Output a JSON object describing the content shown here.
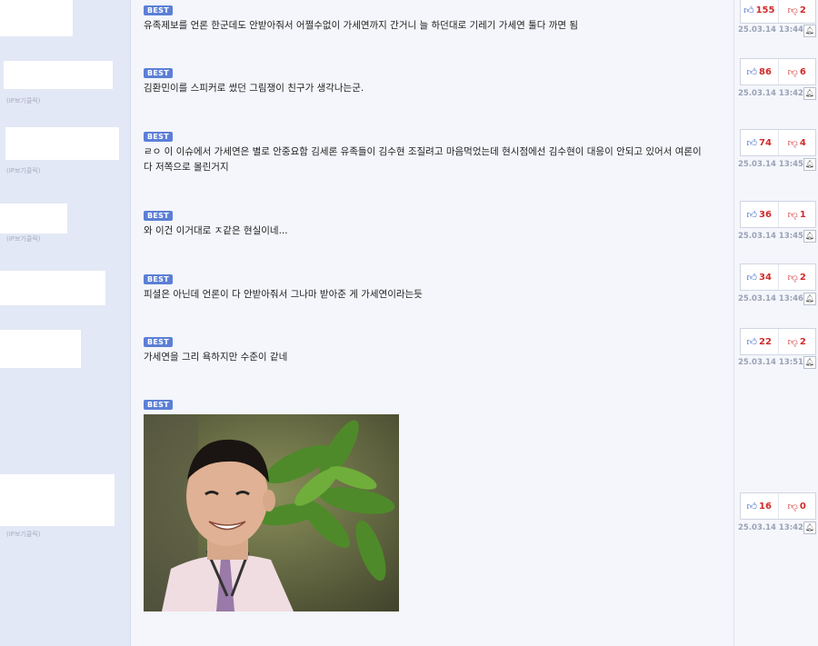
{
  "best_label": "BEST",
  "ip_hint": "(IP보기클릭)",
  "comments": [
    {
      "text": "유족제보를 언론 한군데도 안받아줘서 어쩔수없이 가세연까지 간거니 늘 하던대로 기레기 가세연 툴다 까면 됨",
      "up": "155",
      "down": "2",
      "time": "25.03.14 13:44"
    },
    {
      "text": "김환민이를 스피커로 썼던 그림쟁이 친구가 생각나는군.",
      "up": "86",
      "down": "6",
      "time": "25.03.14 13:42"
    },
    {
      "text": "ㄹㅇ 이 이슈에서 가세연은 별로 안중요함 김세론 유족들이 김수현 조질려고 마음먹었는데 현시점에선 김수현이 대응이 안되고 있어서 여론이 다 저쪽으로 몰린거지",
      "up": "74",
      "down": "4",
      "time": "25.03.14 13:45"
    },
    {
      "text": "와 이건 이거대로 ㅈ같은 현실이네...",
      "up": "36",
      "down": "1",
      "time": "25.03.14 13:45"
    },
    {
      "text": "피셜은 아닌데 언론이 다 안받아줘서 그나마 받아준 게 가세연이라는듯",
      "up": "34",
      "down": "2",
      "time": "25.03.14 13:46"
    },
    {
      "text": "가세연을 그리 욕하지만 수준이 같네",
      "up": "22",
      "down": "2",
      "time": "25.03.14 13:51"
    },
    {
      "text": "",
      "up": "16",
      "down": "0",
      "time": "25.03.14 13:42"
    }
  ],
  "icons": {
    "up": "thumbs-up-icon",
    "down": "thumbs-down-icon",
    "alert": "bell-icon"
  },
  "colors": {
    "best_badge": "#5c7fd6",
    "vote_count": "#d12b2b",
    "left_panel": "#e3e8f6"
  }
}
